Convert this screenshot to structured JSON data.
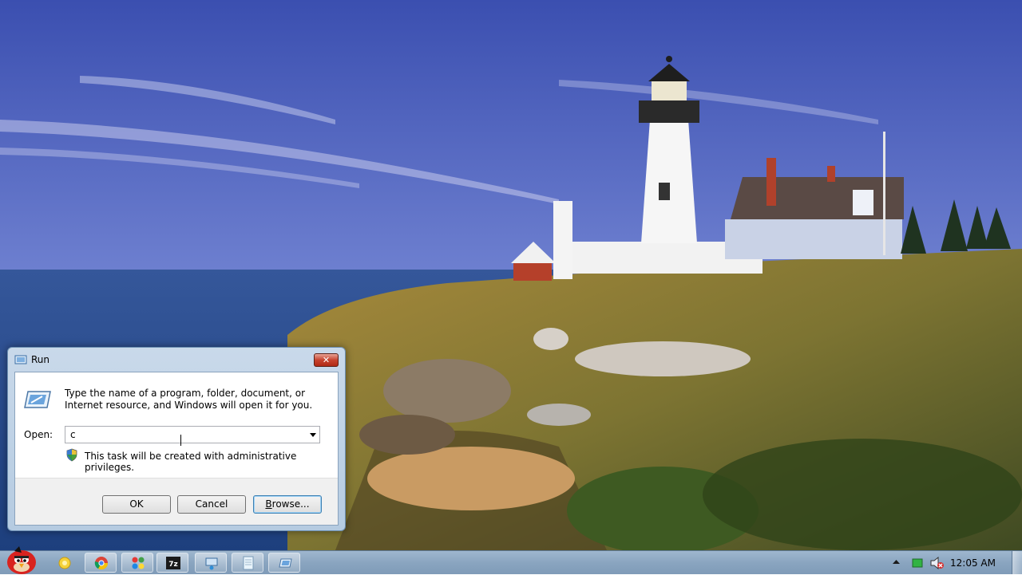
{
  "dialog": {
    "title": "Run",
    "close_label": "✕",
    "description": "Type the name of a program, folder, document, or Internet resource, and Windows will open it for you.",
    "open_label": "Open:",
    "open_value": "c",
    "admin_note": "This task will be created with administrative privileges.",
    "buttons": {
      "ok": "OK",
      "cancel": "Cancel",
      "browse_prefix": "B",
      "browse_rest": "rowse..."
    }
  },
  "taskbar": {
    "icons": [
      "start-orb-icon",
      "folder-icon",
      "chrome-icon",
      "app-grid-icon",
      "7zip-icon",
      "network-drive-icon",
      "notepad-icon",
      "run-window-icon"
    ],
    "tray": {
      "clock": "12:05 AM",
      "icons": [
        "show-hidden-icons-chevron",
        "network-icon",
        "volume-muted-icon"
      ]
    }
  },
  "colors": {
    "sky_top": "#3f57b8",
    "sky_bottom": "#9aa7e0",
    "sea": "#2b4f8f",
    "grass": "#8a7a3a",
    "close_button": "#c7432e",
    "taskbar": "#8aa5c0"
  }
}
